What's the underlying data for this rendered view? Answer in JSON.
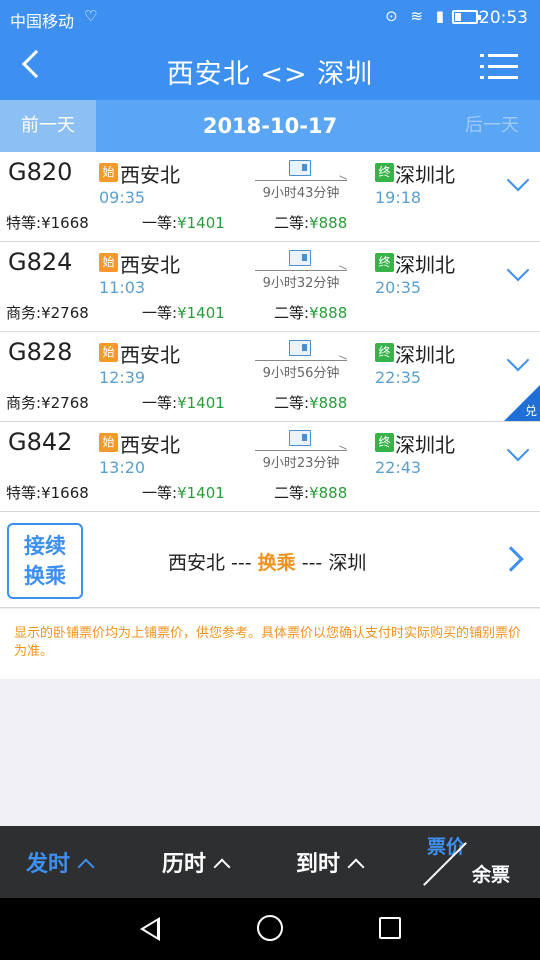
{
  "status": {
    "carrier": "中国移动",
    "time": "20:53"
  },
  "header": {
    "title": "西安北 <> 深圳"
  },
  "datebar": {
    "prev": "前一天",
    "date": "2018-10-17",
    "next": "后一天"
  },
  "trains": [
    {
      "code": "G820",
      "from_tag": "始",
      "from": "西安北",
      "dep": "09:35",
      "duration": "9小时43分钟",
      "to_tag": "终",
      "to": "深圳北",
      "arr": "19:18",
      "seat1_label": "特等:",
      "seat1_price": "¥1668",
      "seat2_label": "一等:",
      "seat2_price": "¥1401",
      "seat3_label": "二等:",
      "seat3_price": "¥888"
    },
    {
      "code": "G824",
      "from_tag": "始",
      "from": "西安北",
      "dep": "11:03",
      "duration": "9小时32分钟",
      "to_tag": "终",
      "to": "深圳北",
      "arr": "20:35",
      "seat1_label": "商务:",
      "seat1_price": "¥2768",
      "seat2_label": "一等:",
      "seat2_price": "¥1401",
      "seat3_label": "二等:",
      "seat3_price": "¥888"
    },
    {
      "code": "G828",
      "from_tag": "始",
      "from": "西安北",
      "dep": "12:39",
      "duration": "9小时56分钟",
      "to_tag": "终",
      "to": "深圳北",
      "arr": "22:35",
      "seat1_label": "商务:",
      "seat1_price": "¥2768",
      "seat2_label": "一等:",
      "seat2_price": "¥1401",
      "seat3_label": "二等:",
      "seat3_price": "¥888",
      "corner": "兑"
    },
    {
      "code": "G842",
      "from_tag": "始",
      "from": "西安北",
      "dep": "13:20",
      "duration": "9小时23分钟",
      "to_tag": "终",
      "to": "深圳北",
      "arr": "22:43",
      "seat1_label": "特等:",
      "seat1_price": "¥1668",
      "seat2_label": "一等:",
      "seat2_price": "¥1401",
      "seat3_label": "二等:",
      "seat3_price": "¥888"
    }
  ],
  "transfer": {
    "badge_line1": "接续",
    "badge_line2": "换乘",
    "from": "西安北 --- ",
    "via": "换乘",
    "to": " --- 深圳"
  },
  "notice": "显示的卧铺票价均为上铺票价，供您参考。具体票价以您确认支付时实际购买的铺别票价为准。",
  "bottom": {
    "sort1": "发时",
    "sort2": "历时",
    "sort3": "到时",
    "price": "票价",
    "stock": "余票"
  },
  "colors": {
    "primary": "#3d8ff0",
    "accent": "#f0931e",
    "price_green": "#2a9d3a"
  }
}
